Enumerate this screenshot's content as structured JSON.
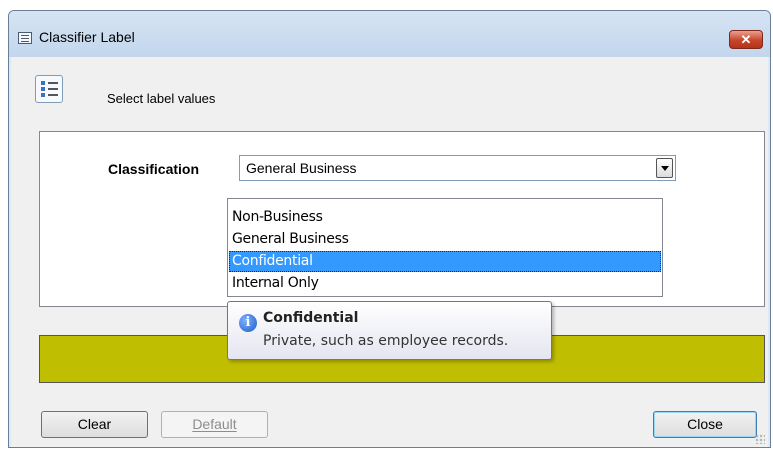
{
  "window": {
    "title": "Classifier Label",
    "close_glyph": "✕"
  },
  "header": {
    "icon": "checklist-icon",
    "text": "Select label values"
  },
  "classification": {
    "label": "Classification",
    "selected_value": "General Business",
    "options": [
      "Non-Business",
      "General Business",
      "Confidential",
      "Internal Only"
    ],
    "highlighted_option": "Confidential"
  },
  "tooltip": {
    "icon": "info-icon",
    "icon_glyph": "i",
    "title": "Confidential",
    "description": "Private, such as employee records."
  },
  "status_bar": {
    "color": "#c0be00"
  },
  "buttons": {
    "clear": "Clear",
    "default": "Default",
    "close": "Close"
  },
  "colors": {
    "selection": "#3399ff",
    "close_button": "#c6452b"
  }
}
